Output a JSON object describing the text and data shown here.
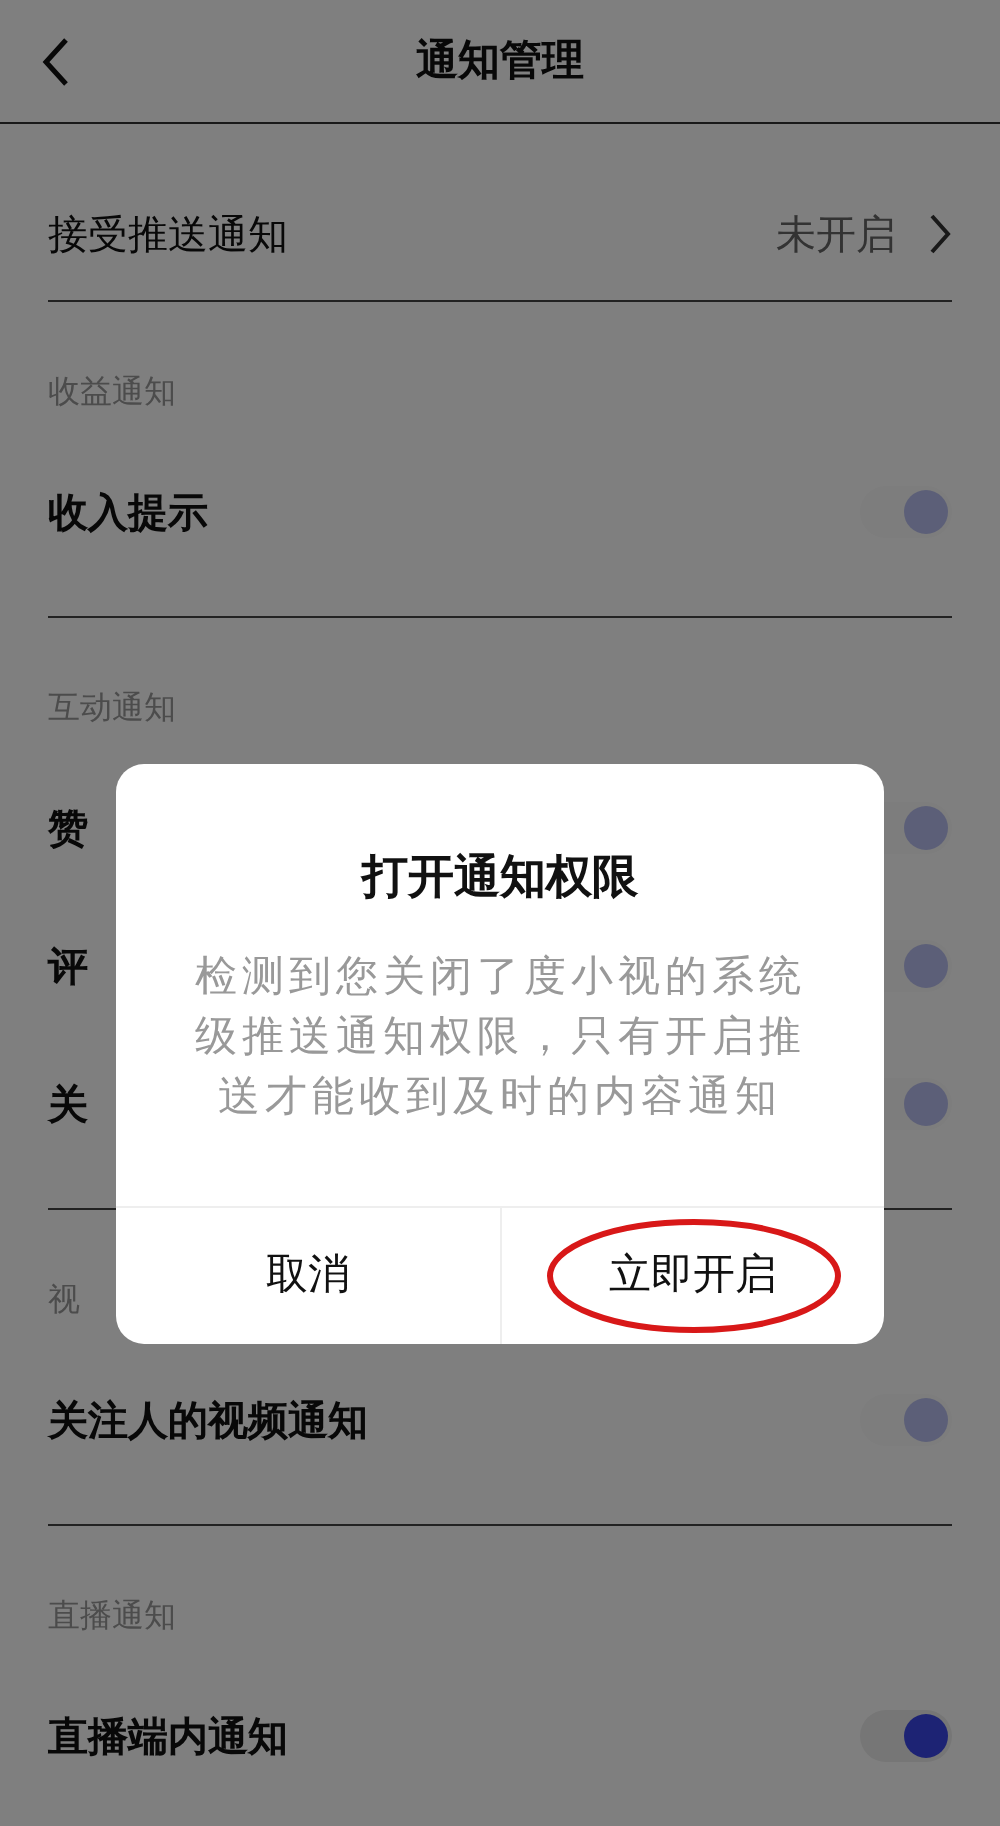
{
  "header": {
    "title": "通知管理"
  },
  "push_row": {
    "label": "接受推送通知",
    "value": "未开启"
  },
  "sections": [
    {
      "title": "收益通知",
      "items": [
        {
          "label": "收入提示",
          "on": true,
          "disabled": true
        }
      ]
    },
    {
      "title": "互动通知",
      "items": [
        {
          "label": "赞",
          "on": true,
          "disabled": true
        },
        {
          "label": "评",
          "on": true,
          "disabled": true
        },
        {
          "label": "关",
          "on": true,
          "disabled": true
        }
      ]
    },
    {
      "title": "视",
      "items": [
        {
          "label": "关注人的视频通知",
          "on": true,
          "disabled": true
        }
      ]
    },
    {
      "title": "直播通知",
      "items": [
        {
          "label": "直播端内通知",
          "on": true,
          "disabled": false
        }
      ]
    }
  ],
  "dialog": {
    "title": "打开通知权限",
    "message": "检测到您关闭了度小视的系统级推送通知权限，只有开启推送才能收到及时的内容通知",
    "buttons": [
      {
        "label": "取消",
        "highlighted": false
      },
      {
        "label": "立即开启",
        "highlighted": true
      }
    ]
  }
}
